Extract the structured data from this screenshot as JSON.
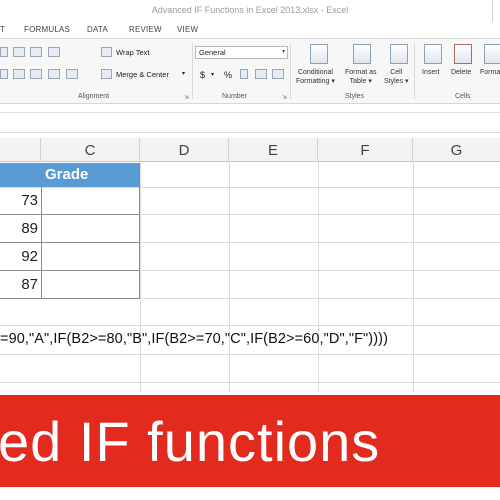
{
  "window": {
    "title": "Advanced IF Functions in Excel 2013.xlsx - Excel"
  },
  "ribbon": {
    "tabs": [
      "T",
      "FORMULAS",
      "DATA",
      "REVIEW",
      "VIEW"
    ],
    "alignment": {
      "wrap_text": "Wrap Text",
      "merge_center": "Merge & Center",
      "group_label": "Alignment"
    },
    "number": {
      "format_value": "General",
      "currency": "$",
      "percent": "%",
      "comma": "▾",
      "group_label": "Number"
    },
    "styles": {
      "conditional_formatting": "Conditional",
      "conditional_formatting_2": "Formatting ▾",
      "format_as_table": "Format as",
      "format_as_table_2": "Table ▾",
      "cell_styles": "Cell",
      "cell_styles_2": "Styles ▾",
      "group_label": "Styles"
    },
    "cells": {
      "insert": "Insert",
      "delete": "Delete",
      "format": "Forma",
      "group_label": "Cells"
    }
  },
  "columns": [
    "C",
    "D",
    "E",
    "F",
    "G"
  ],
  "table": {
    "header_grade": "Grade",
    "scores": [
      "73",
      "89",
      "92",
      "87"
    ]
  },
  "formula_text": "=90,\"A\",IF(B2>=80,\"B\",IF(B2>=70,\"C\",IF(B2>=60,\"D\",\"F\"))))",
  "banner": {
    "text": "ed IF functions"
  },
  "colors": {
    "banner": "#e32a1e",
    "table_header": "#5b9bd5"
  }
}
